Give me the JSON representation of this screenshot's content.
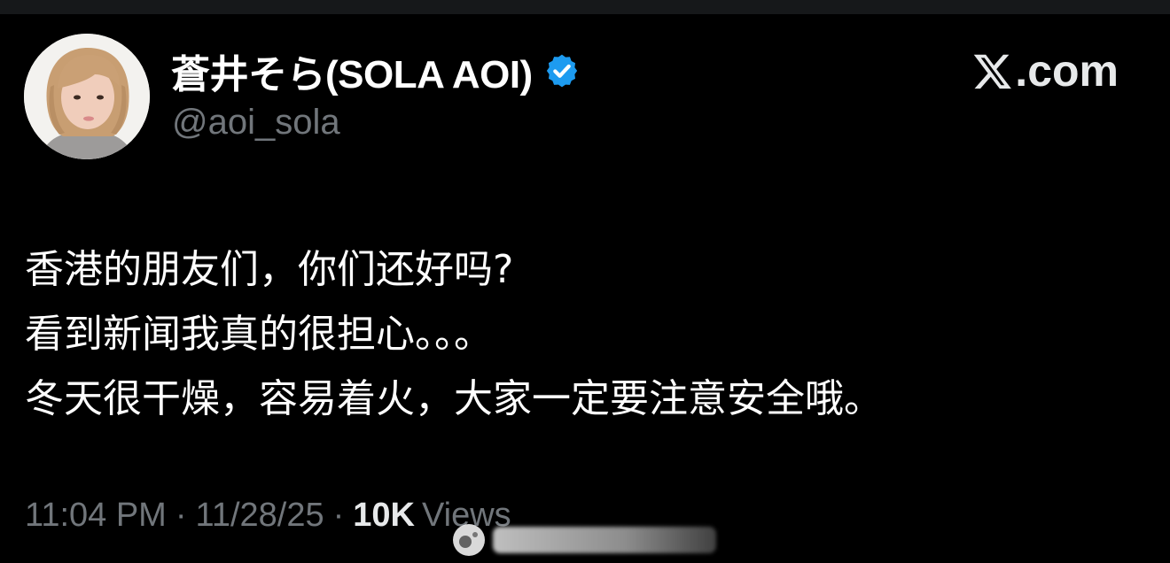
{
  "tweet": {
    "display_name": "蒼井そら(SOLA AOI)",
    "handle": "@aoi_sola",
    "verified_color": "#1d9bf0",
    "lines": [
      "香港的朋友们，你们还好吗?",
      "看到新闻我真的很担心。。。",
      "冬天很干燥，容易着火，大家一定要注意安全哦。"
    ],
    "time": "11:04 PM",
    "date": "11/28/25",
    "separator": "·",
    "views_count": "10K",
    "views_label": "Views"
  },
  "brand": {
    "suffix": ".com",
    "icon": "x-logo-icon"
  },
  "colors": {
    "background": "#000000",
    "secondary_text": "#71767b",
    "primary_text": "#ffffff"
  }
}
